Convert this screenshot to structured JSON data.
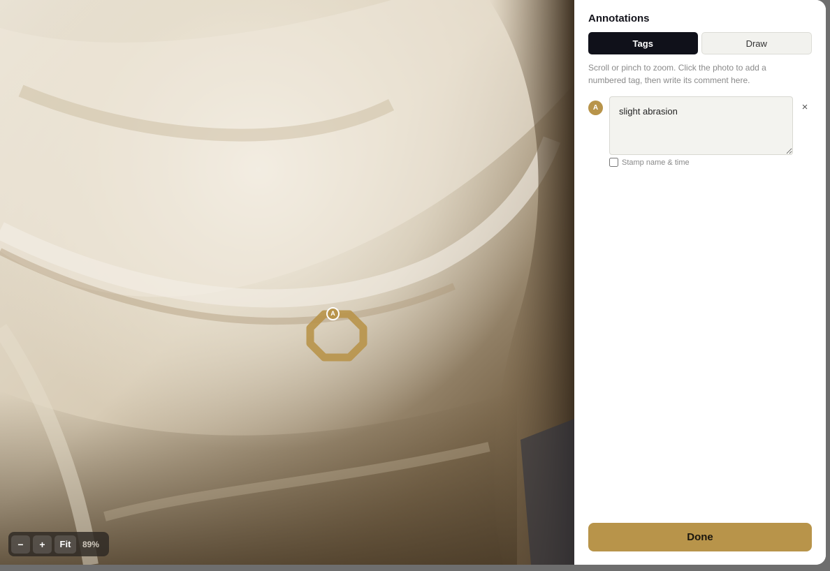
{
  "photo": {
    "alt_subject": "marble-drapery-photo",
    "tags": [
      {
        "letter": "A"
      }
    ],
    "zoom": {
      "minus_label": "−",
      "plus_label": "+",
      "fit_label": "Fit",
      "level": "89%"
    }
  },
  "panel": {
    "title": "Annotations",
    "tabs": [
      {
        "label": "Tags",
        "active": true
      },
      {
        "label": "Draw",
        "active": false
      }
    ],
    "hint": "Scroll or pinch to zoom. Click the photo to add a numbered tag, then write its comment here.",
    "tag_entries": [
      {
        "letter": "A",
        "comment": "slight abrasion",
        "remove_icon": "×",
        "stamp_label": "Stamp name & time",
        "stamp_checked": false
      }
    ],
    "done_label": "Done"
  },
  "colors": {
    "accent": "#b8944a",
    "tab_active_bg": "#10111a",
    "hint_text": "#8a8a8a"
  }
}
